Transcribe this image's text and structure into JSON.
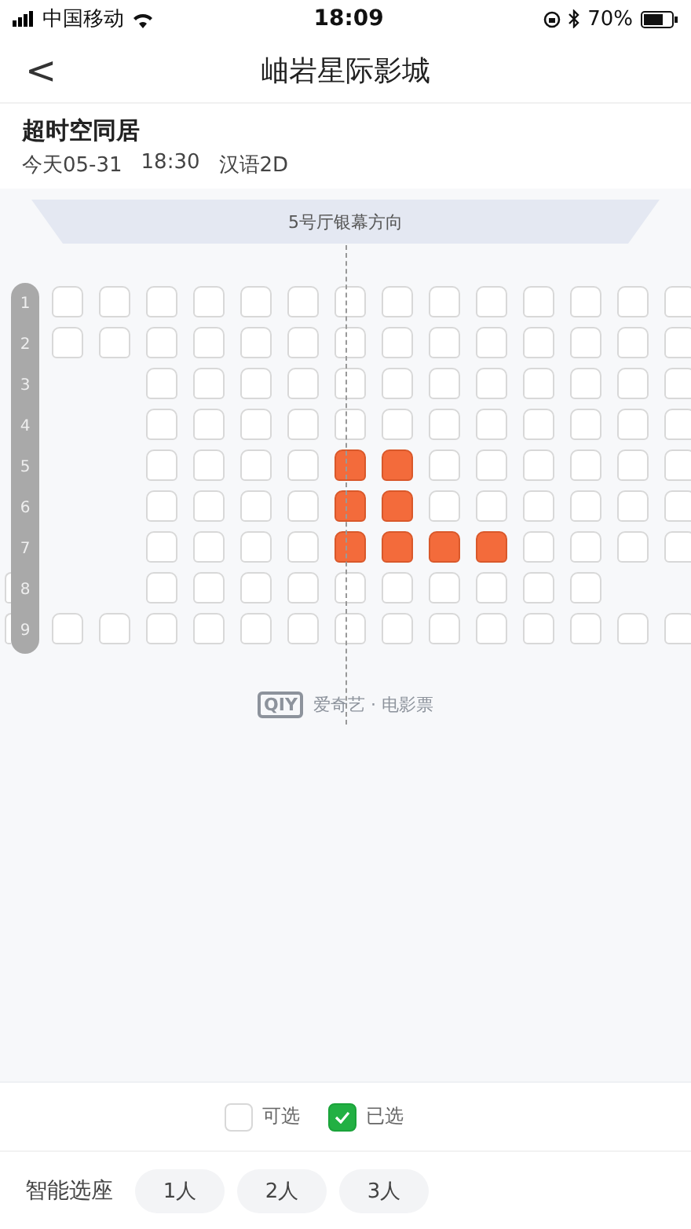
{
  "status_bar": {
    "carrier": "中国移动",
    "time": "18:09",
    "battery": "70%"
  },
  "nav": {
    "back": "<",
    "title": "岫岩星际影城"
  },
  "show": {
    "movie": "超时空同居",
    "date": "今天05-31",
    "time": "18:30",
    "format": "汉语2D"
  },
  "screen": {
    "label": "5号厅银幕方向"
  },
  "rows": [
    {
      "label": "1",
      "seats": [
        {
          "kind": "gap"
        },
        {
          "kind": "seat",
          "selected": false
        },
        {
          "kind": "seat",
          "selected": false
        },
        {
          "kind": "seat",
          "selected": false
        },
        {
          "kind": "seat",
          "selected": false
        },
        {
          "kind": "seat",
          "selected": false
        },
        {
          "kind": "seat",
          "selected": false
        },
        {
          "kind": "seat",
          "selected": false
        },
        {
          "kind": "seat",
          "selected": false
        },
        {
          "kind": "seat",
          "selected": false
        },
        {
          "kind": "seat",
          "selected": false
        },
        {
          "kind": "seat",
          "selected": false
        },
        {
          "kind": "seat",
          "selected": false
        },
        {
          "kind": "seat",
          "selected": false
        },
        {
          "kind": "seat",
          "selected": false
        }
      ]
    },
    {
      "label": "2",
      "seats": [
        {
          "kind": "gap"
        },
        {
          "kind": "seat",
          "selected": false
        },
        {
          "kind": "seat",
          "selected": false
        },
        {
          "kind": "seat",
          "selected": false
        },
        {
          "kind": "seat",
          "selected": false
        },
        {
          "kind": "seat",
          "selected": false
        },
        {
          "kind": "seat",
          "selected": false
        },
        {
          "kind": "seat",
          "selected": false
        },
        {
          "kind": "seat",
          "selected": false
        },
        {
          "kind": "seat",
          "selected": false
        },
        {
          "kind": "seat",
          "selected": false
        },
        {
          "kind": "seat",
          "selected": false
        },
        {
          "kind": "seat",
          "selected": false
        },
        {
          "kind": "seat",
          "selected": false
        },
        {
          "kind": "seat",
          "selected": false
        }
      ]
    },
    {
      "label": "3",
      "seats": [
        {
          "kind": "gap"
        },
        {
          "kind": "gap"
        },
        {
          "kind": "gap"
        },
        {
          "kind": "seat",
          "selected": false
        },
        {
          "kind": "seat",
          "selected": false
        },
        {
          "kind": "seat",
          "selected": false
        },
        {
          "kind": "seat",
          "selected": false
        },
        {
          "kind": "seat",
          "selected": false
        },
        {
          "kind": "seat",
          "selected": false
        },
        {
          "kind": "seat",
          "selected": false
        },
        {
          "kind": "seat",
          "selected": false
        },
        {
          "kind": "seat",
          "selected": false
        },
        {
          "kind": "seat",
          "selected": false
        },
        {
          "kind": "seat",
          "selected": false
        },
        {
          "kind": "seat",
          "selected": false
        }
      ]
    },
    {
      "label": "4",
      "seats": [
        {
          "kind": "gap"
        },
        {
          "kind": "gap"
        },
        {
          "kind": "gap"
        },
        {
          "kind": "seat",
          "selected": false
        },
        {
          "kind": "seat",
          "selected": false
        },
        {
          "kind": "seat",
          "selected": false
        },
        {
          "kind": "seat",
          "selected": false
        },
        {
          "kind": "seat",
          "selected": false
        },
        {
          "kind": "seat",
          "selected": false
        },
        {
          "kind": "seat",
          "selected": false
        },
        {
          "kind": "seat",
          "selected": false
        },
        {
          "kind": "seat",
          "selected": false
        },
        {
          "kind": "seat",
          "selected": false
        },
        {
          "kind": "seat",
          "selected": false
        },
        {
          "kind": "seat",
          "selected": false
        }
      ]
    },
    {
      "label": "5",
      "seats": [
        {
          "kind": "gap"
        },
        {
          "kind": "gap"
        },
        {
          "kind": "gap"
        },
        {
          "kind": "seat",
          "selected": false
        },
        {
          "kind": "seat",
          "selected": false
        },
        {
          "kind": "seat",
          "selected": false
        },
        {
          "kind": "seat",
          "selected": false
        },
        {
          "kind": "seat",
          "selected": true
        },
        {
          "kind": "seat",
          "selected": true
        },
        {
          "kind": "seat",
          "selected": false
        },
        {
          "kind": "seat",
          "selected": false
        },
        {
          "kind": "seat",
          "selected": false
        },
        {
          "kind": "seat",
          "selected": false
        },
        {
          "kind": "seat",
          "selected": false
        },
        {
          "kind": "seat",
          "selected": false
        }
      ]
    },
    {
      "label": "6",
      "seats": [
        {
          "kind": "gap"
        },
        {
          "kind": "gap"
        },
        {
          "kind": "gap"
        },
        {
          "kind": "seat",
          "selected": false
        },
        {
          "kind": "seat",
          "selected": false
        },
        {
          "kind": "seat",
          "selected": false
        },
        {
          "kind": "seat",
          "selected": false
        },
        {
          "kind": "seat",
          "selected": true
        },
        {
          "kind": "seat",
          "selected": true
        },
        {
          "kind": "seat",
          "selected": false
        },
        {
          "kind": "seat",
          "selected": false
        },
        {
          "kind": "seat",
          "selected": false
        },
        {
          "kind": "seat",
          "selected": false
        },
        {
          "kind": "seat",
          "selected": false
        },
        {
          "kind": "seat",
          "selected": false
        }
      ]
    },
    {
      "label": "7",
      "seats": [
        {
          "kind": "gap"
        },
        {
          "kind": "gap"
        },
        {
          "kind": "gap"
        },
        {
          "kind": "seat",
          "selected": false
        },
        {
          "kind": "seat",
          "selected": false
        },
        {
          "kind": "seat",
          "selected": false
        },
        {
          "kind": "seat",
          "selected": false
        },
        {
          "kind": "seat",
          "selected": true
        },
        {
          "kind": "seat",
          "selected": true
        },
        {
          "kind": "seat",
          "selected": true
        },
        {
          "kind": "seat",
          "selected": true
        },
        {
          "kind": "seat",
          "selected": false
        },
        {
          "kind": "seat",
          "selected": false
        },
        {
          "kind": "seat",
          "selected": false
        },
        {
          "kind": "seat",
          "selected": false
        }
      ]
    },
    {
      "label": "8",
      "seats": [
        {
          "kind": "seat",
          "selected": false
        },
        {
          "kind": "gap"
        },
        {
          "kind": "gap"
        },
        {
          "kind": "seat",
          "selected": false
        },
        {
          "kind": "seat",
          "selected": false
        },
        {
          "kind": "seat",
          "selected": false
        },
        {
          "kind": "seat",
          "selected": false
        },
        {
          "kind": "seat",
          "selected": false
        },
        {
          "kind": "seat",
          "selected": false
        },
        {
          "kind": "seat",
          "selected": false
        },
        {
          "kind": "seat",
          "selected": false
        },
        {
          "kind": "seat",
          "selected": false
        },
        {
          "kind": "seat",
          "selected": false
        },
        {
          "kind": "gap"
        },
        {
          "kind": "gap"
        }
      ]
    },
    {
      "label": "9",
      "seats": [
        {
          "kind": "seat",
          "selected": false
        },
        {
          "kind": "seat",
          "selected": false
        },
        {
          "kind": "seat",
          "selected": false
        },
        {
          "kind": "seat",
          "selected": false
        },
        {
          "kind": "seat",
          "selected": false
        },
        {
          "kind": "seat",
          "selected": false
        },
        {
          "kind": "seat",
          "selected": false
        },
        {
          "kind": "seat",
          "selected": false
        },
        {
          "kind": "seat",
          "selected": false
        },
        {
          "kind": "seat",
          "selected": false
        },
        {
          "kind": "seat",
          "selected": false
        },
        {
          "kind": "seat",
          "selected": false
        },
        {
          "kind": "seat",
          "selected": false
        },
        {
          "kind": "seat",
          "selected": false
        },
        {
          "kind": "seat",
          "selected": false
        }
      ]
    }
  ],
  "brand": {
    "logo": "QIY",
    "text": "爱奇艺 · 电影票"
  },
  "legend": [
    {
      "kind": "available",
      "label": "可选"
    },
    {
      "kind": "selected",
      "label": "已选"
    }
  ],
  "smart_select": {
    "label": "智能选座",
    "options": [
      "1人",
      "2人",
      "3人"
    ]
  }
}
